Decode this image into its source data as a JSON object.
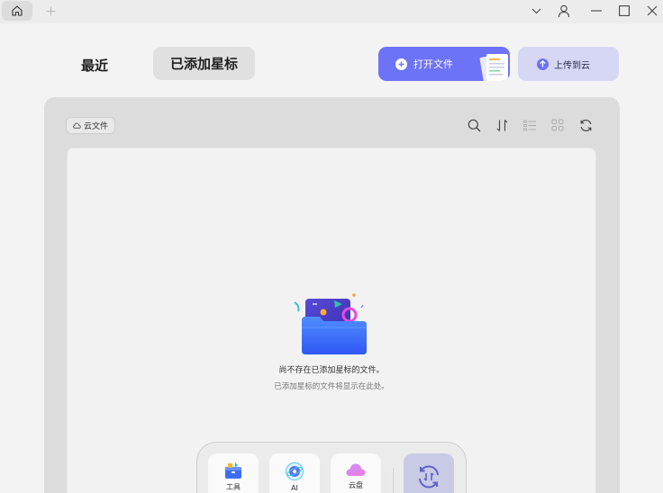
{
  "titlebar": {
    "icons": [
      "home-icon",
      "plus-icon",
      "chevron-down-icon",
      "user-icon",
      "minimize-icon",
      "maximize-icon",
      "close-icon"
    ]
  },
  "header": {
    "tabs": [
      {
        "label": "最近",
        "active": false
      },
      {
        "label": "已添加星标",
        "active": true
      }
    ],
    "open_file_label": "打开文件",
    "upload_label": "上传到云"
  },
  "toolbar": {
    "cloud_chip_label": "云文件",
    "icons": [
      "search-icon",
      "sort-icon",
      "list-view-icon",
      "grid-view-icon",
      "refresh-icon"
    ]
  },
  "empty_state": {
    "title": "尚不存在已添加星标的文件。",
    "subtitle": "已添加星标的文件将显示在此处。"
  },
  "dock": {
    "items": [
      {
        "label": "工具",
        "icon": "toolbox-icon"
      },
      {
        "label": "AI",
        "icon": "ai-icon"
      },
      {
        "label": "云盘",
        "icon": "cloud-icon"
      }
    ],
    "sync_icon": "sync-icon"
  },
  "colors": {
    "accent": "#6d73f7",
    "accent_light": "#d6d7f4",
    "panel_bg": "#dcdcdc",
    "content_bg": "#f2f2f2"
  }
}
